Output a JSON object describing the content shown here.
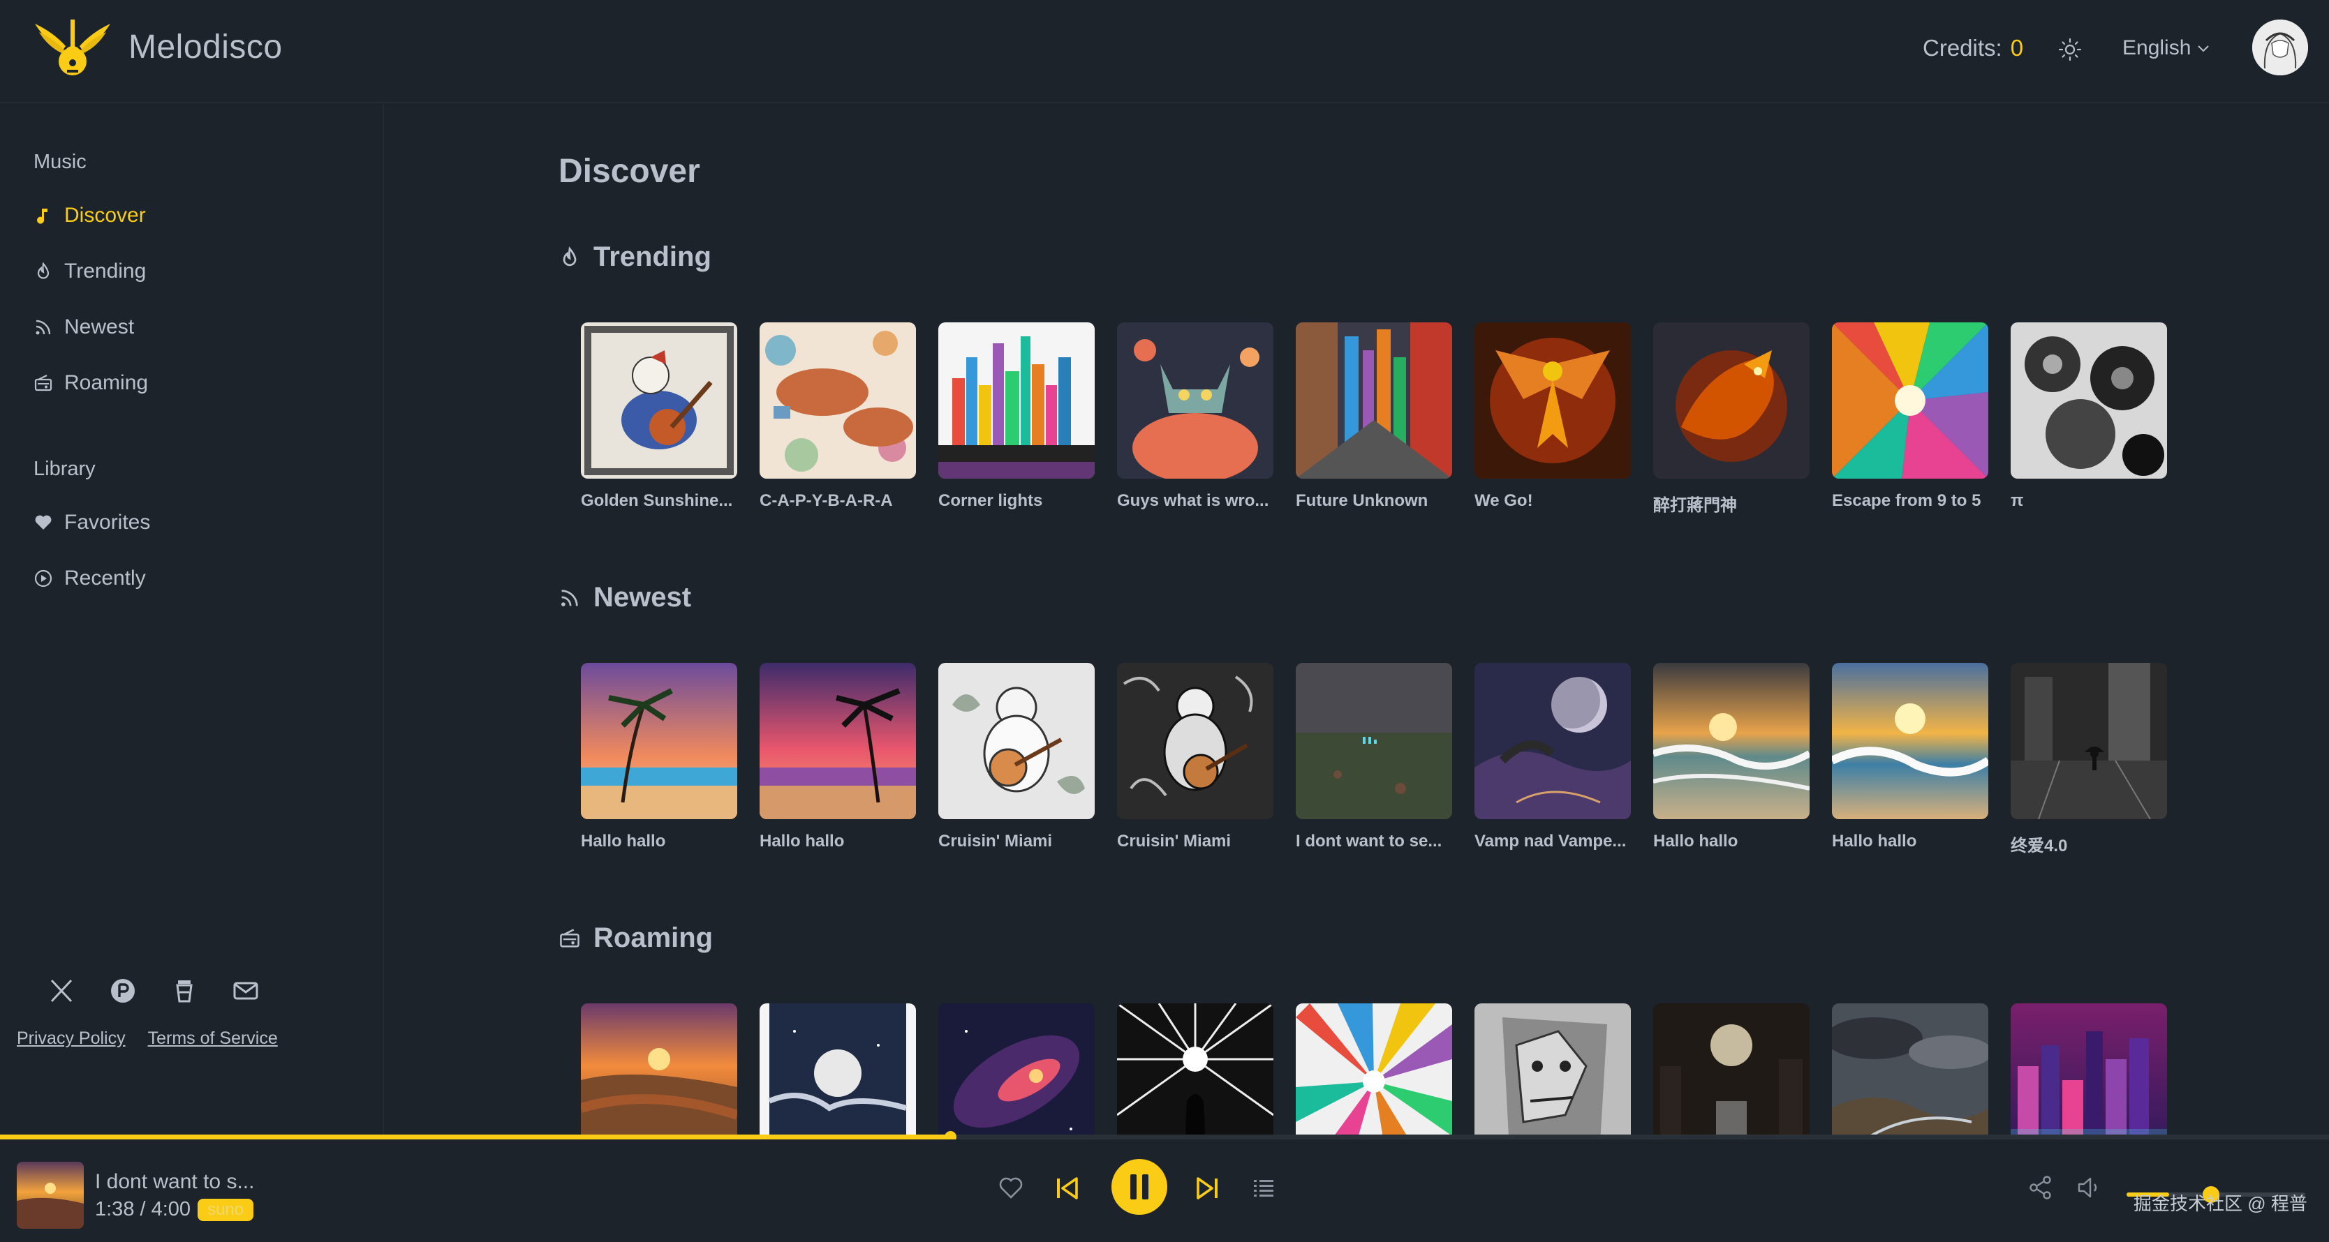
{
  "app": {
    "brand": "Melodisco",
    "credits_label": "Credits:",
    "credits_value": "0",
    "language": "English"
  },
  "sidebar": {
    "music_title": "Music",
    "music_items": [
      {
        "label": "Discover",
        "icon": "music-note-icon",
        "active": true
      },
      {
        "label": "Trending",
        "icon": "flame-icon"
      },
      {
        "label": "Newest",
        "icon": "rss-icon"
      },
      {
        "label": "Roaming",
        "icon": "radio-icon"
      }
    ],
    "library_title": "Library",
    "library_items": [
      {
        "label": "Favorites",
        "icon": "heart-icon"
      },
      {
        "label": "Recently",
        "icon": "play-circle-icon"
      }
    ],
    "privacy": "Privacy Policy",
    "terms": "Terms of Service"
  },
  "main": {
    "title": "Discover",
    "trending": {
      "title": "Trending",
      "items": [
        "Golden Sunshine...",
        "C-A-P-Y-B-A-R-A",
        "Corner lights",
        "Guys what is wro...",
        "Future Unknown",
        "We Go!",
        "醉打蔣門神",
        "Escape from 9 to 5",
        "π"
      ]
    },
    "newest": {
      "title": "Newest",
      "items": [
        "Hallo hallo",
        "Hallo hallo",
        "Cruisin' Miami",
        "Cruisin' Miami",
        "I dont want to se...",
        "Vamp nad Vampe...",
        "Hallo hallo",
        "Hallo hallo",
        "终爱4.0"
      ]
    },
    "roaming": {
      "title": "Roaming"
    }
  },
  "player": {
    "title": "I dont want to s...",
    "time": "1:38 / 4:00",
    "badge": "suno",
    "progress": 0.408,
    "volume": 0.24,
    "watermark": "掘金技术社区 @ 程普"
  },
  "colors": {
    "accent": "#facc15",
    "background": "#1d232a",
    "text": "#b9c0cc"
  }
}
